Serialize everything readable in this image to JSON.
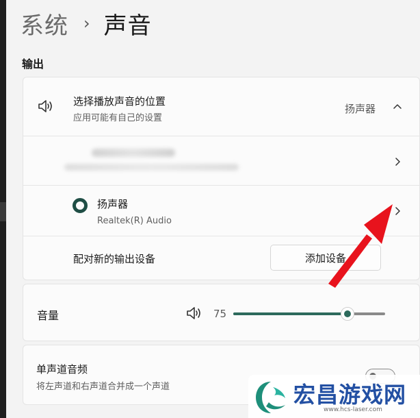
{
  "breadcrumb": {
    "parent": "系统",
    "separator": "›",
    "current": "声音"
  },
  "output": {
    "section_title": "输出",
    "choose_location": {
      "icon": "speaker-icon",
      "title": "选择播放声音的位置",
      "subtitle": "应用可能有自己的设置",
      "selected_value": "扬声器",
      "expand_icon": "chevron-up-icon"
    },
    "devices": [
      {
        "name": "",
        "detail": "",
        "obscured": true,
        "selected": false
      },
      {
        "name": "扬声器",
        "detail": "Realtek(R) Audio",
        "obscured": false,
        "selected": true
      }
    ],
    "pair_device": {
      "label": "配对新的输出设备",
      "button_label": "添加设备"
    }
  },
  "volume": {
    "label": "音量",
    "icon": "speaker-icon",
    "value": "75",
    "level_percent": 75
  },
  "mono_audio": {
    "title": "单声道音频",
    "subtitle": "将左声道和右声道合并成一个声道",
    "enabled": false
  },
  "watermark": {
    "name": "宏昌游戏网",
    "url": "www.hcs-laser.com"
  },
  "colors": {
    "accent": "#2d6a5c",
    "annotation_arrow": "#e8131d",
    "watermark_text": "#2350a3"
  }
}
